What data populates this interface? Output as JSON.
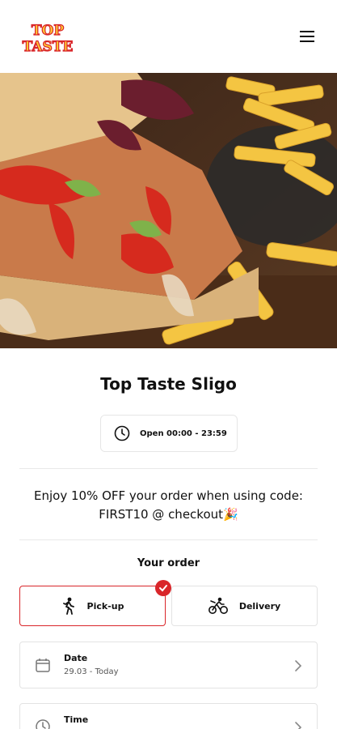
{
  "header": {
    "logo_line1": "TOP",
    "logo_line2": "TASTE",
    "brand_color": "#d9262a",
    "logo_fill": "#ffcc33"
  },
  "hero": {
    "image_description_icon": "sandwich-and-fries-photo"
  },
  "store": {
    "name": "Top Taste Sligo",
    "hours": "Open 00:00 - 23:59"
  },
  "promo": {
    "line1": "Enjoy 10% OFF your order when using code:",
    "line2": "FIRST10 @ checkout",
    "emoji": "🎉"
  },
  "order": {
    "heading": "Your order",
    "modes": [
      {
        "label": "Pick-up",
        "selected": true,
        "icon": "walking-person-icon"
      },
      {
        "label": "Delivery",
        "selected": false,
        "icon": "cyclist-icon"
      }
    ],
    "date": {
      "title": "Date",
      "value": "29.03 - Today"
    },
    "time": {
      "title": "Time",
      "value": ""
    }
  }
}
